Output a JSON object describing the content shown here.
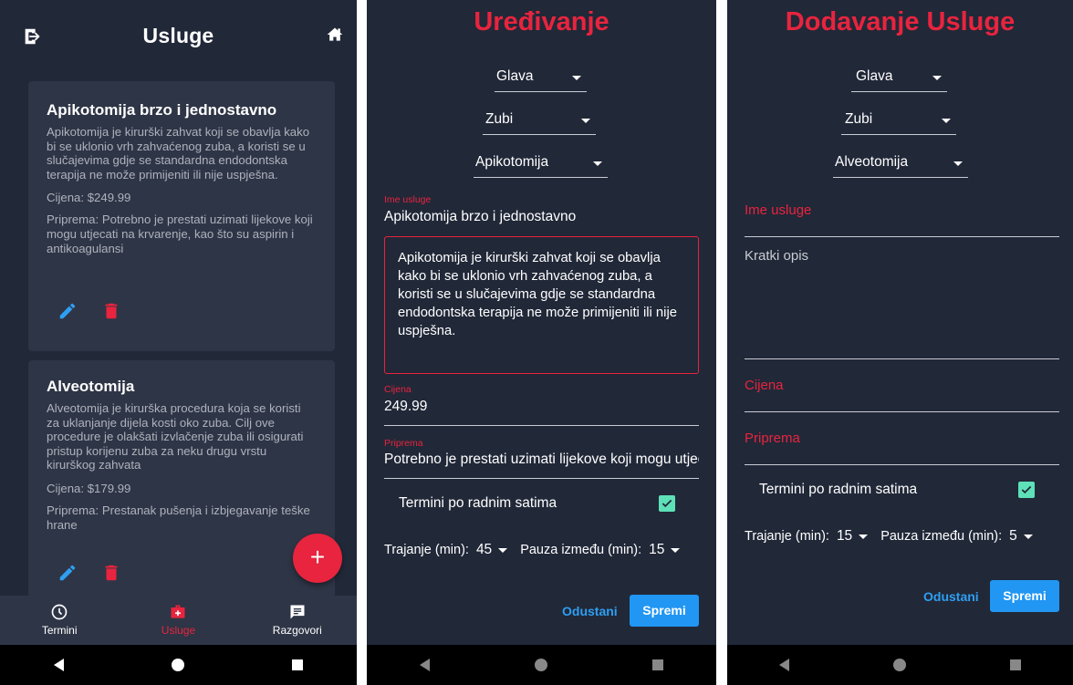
{
  "screen1": {
    "title": "Usluge",
    "cards": [
      {
        "title": "Apikotomija brzo i jednostavno",
        "description": "Apikotomija je kirurški zahvat koji se obavlja kako bi se uklonio vrh zahvaćenog zuba, a koristi se u slučajevima gdje se standardna endodontska terapija ne može primijeniti ili nije uspješna.",
        "price": "Cijena: $249.99",
        "prep": "Priprema: Potrebno je prestati uzimati lijekove koji mogu utjecati na krvarenje, kao što su aspirin i antikoagulansi"
      },
      {
        "title": "Alveotomija",
        "description": "Alveotomija je kirurška procedura koja se koristi za uklanjanje dijela kosti oko zuba. Cilj ove procedure je olakšati izvlačenje zuba ili osigurati pristup korijenu zuba za neku drugu vrstu kirurškog zahvata",
        "price": "Cijena: $179.99",
        "prep": "Priprema: Prestanak pušenja i izbjegavanje teške hrane"
      }
    ],
    "fab_label": "+",
    "bottom_nav": [
      {
        "label": "Termini",
        "icon": "clock-icon"
      },
      {
        "label": "Usluge",
        "icon": "medical-kit-icon",
        "active": true
      },
      {
        "label": "Razgovori",
        "icon": "chat-icon"
      }
    ]
  },
  "screen2": {
    "title": "Uređivanje",
    "dropdowns": [
      "Glava",
      "Zubi",
      "Apikotomija"
    ],
    "name_label": "Ime usluge",
    "name_value": "Apikotomija brzo i jednostavno",
    "description_value": "Apikotomija je kirurški zahvat koji se obavlja kako bi se uklonio vrh zahvaćenog zuba, a koristi se u slučajevima gdje se standardna endodontska terapija ne može primijeniti ili nije uspješna.",
    "price_label": "Cijena",
    "price_value": "249.99",
    "prep_label": "Priprema",
    "prep_value": "Potrebno je prestati uzimati lijekove koji mogu utjecati na krvarenje",
    "working_hours_label": "Termini po radnim satima",
    "working_hours_checked": true,
    "duration_label": "Trajanje (min):",
    "duration_value": "45",
    "pause_label": "Pauza između (min):",
    "pause_value": "15",
    "cancel_label": "Odustani",
    "save_label": "Spremi"
  },
  "screen3": {
    "title": "Dodavanje Usluge",
    "dropdowns": [
      "Glava",
      "Zubi",
      "Alveotomija"
    ],
    "name_placeholder": "Ime usluge",
    "description_placeholder": "Kratki opis",
    "price_placeholder": "Cijena",
    "prep_placeholder": "Priprema",
    "working_hours_label": "Termini po radnim satima",
    "working_hours_checked": true,
    "duration_label": "Trajanje (min):",
    "duration_value": "15",
    "pause_label": "Pauza između (min):",
    "pause_value": "5",
    "cancel_label": "Odustani",
    "save_label": "Spremi"
  },
  "colors": {
    "background": "#212838",
    "card": "#2e3546",
    "accent": "#e8243e",
    "primary": "#2196f3",
    "checkbox": "#5ee0b8"
  }
}
